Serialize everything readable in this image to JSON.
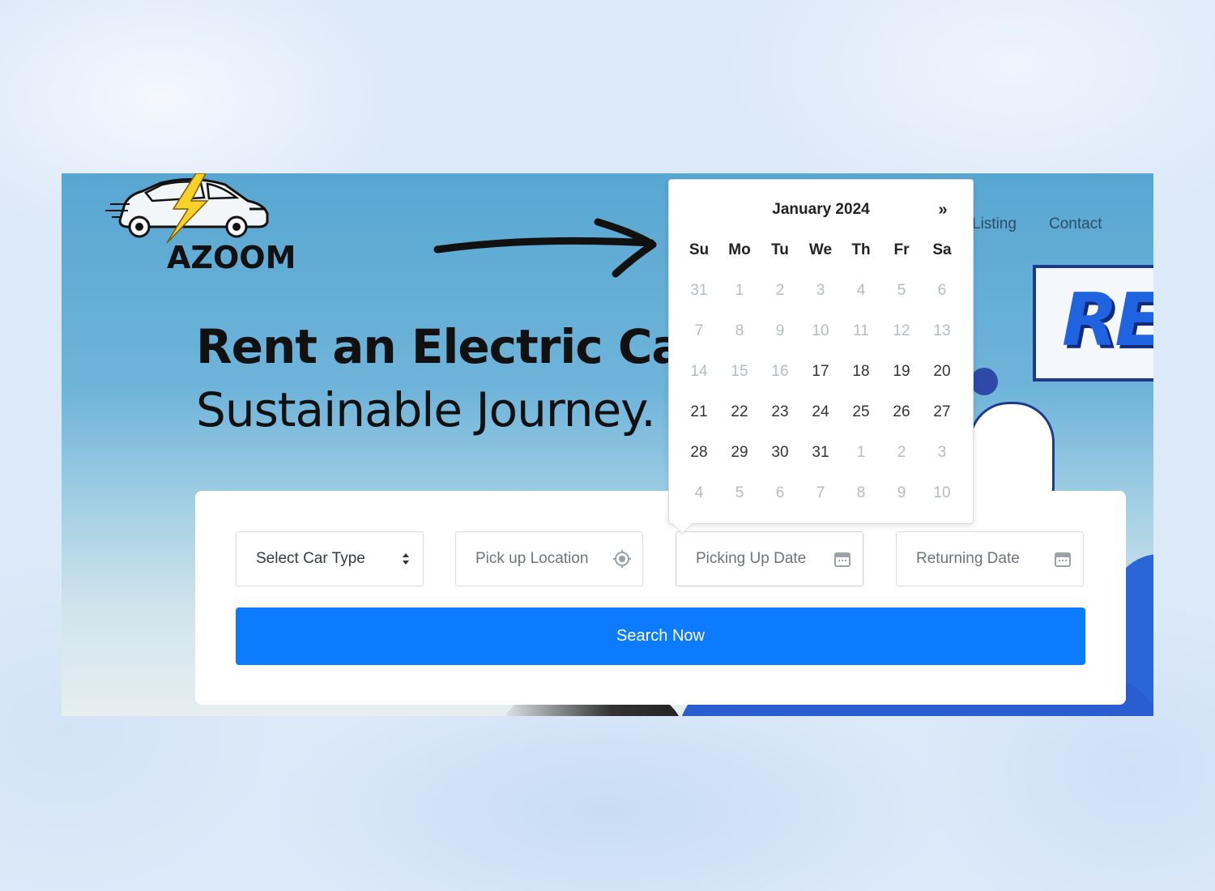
{
  "brand": {
    "name": "AZOOM"
  },
  "nav": {
    "items": [
      "Listing",
      "Contact"
    ]
  },
  "hero": {
    "title": "Rent an Electric Car",
    "subtitle": "Sustainable Journey."
  },
  "illustration": {
    "sign_text": "RE"
  },
  "search": {
    "car_type": "Select Car Type",
    "pickup_location": "Pick up Location",
    "pickup_date": "Picking Up Date",
    "return_date": "Returning Date",
    "submit": "Search Now"
  },
  "datepicker": {
    "month_label": "January 2024",
    "next_label": "»",
    "weekdays": [
      "Su",
      "Mo",
      "Tu",
      "We",
      "Th",
      "Fr",
      "Sa"
    ],
    "weeks": [
      [
        {
          "d": "31",
          "m": true
        },
        {
          "d": "1",
          "m": true
        },
        {
          "d": "2",
          "m": true
        },
        {
          "d": "3",
          "m": true
        },
        {
          "d": "4",
          "m": true
        },
        {
          "d": "5",
          "m": true
        },
        {
          "d": "6",
          "m": true
        }
      ],
      [
        {
          "d": "7",
          "m": true
        },
        {
          "d": "8",
          "m": true
        },
        {
          "d": "9",
          "m": true
        },
        {
          "d": "10",
          "m": true
        },
        {
          "d": "11",
          "m": true
        },
        {
          "d": "12",
          "m": true
        },
        {
          "d": "13",
          "m": true
        }
      ],
      [
        {
          "d": "14",
          "m": true
        },
        {
          "d": "15",
          "m": true
        },
        {
          "d": "16",
          "m": true
        },
        {
          "d": "17",
          "m": false
        },
        {
          "d": "18",
          "m": false
        },
        {
          "d": "19",
          "m": false
        },
        {
          "d": "20",
          "m": false
        }
      ],
      [
        {
          "d": "21",
          "m": false
        },
        {
          "d": "22",
          "m": false
        },
        {
          "d": "23",
          "m": false
        },
        {
          "d": "24",
          "m": false
        },
        {
          "d": "25",
          "m": false
        },
        {
          "d": "26",
          "m": false
        },
        {
          "d": "27",
          "m": false
        }
      ],
      [
        {
          "d": "28",
          "m": false
        },
        {
          "d": "29",
          "m": false
        },
        {
          "d": "30",
          "m": false
        },
        {
          "d": "31",
          "m": false
        },
        {
          "d": "1",
          "m": true
        },
        {
          "d": "2",
          "m": true
        },
        {
          "d": "3",
          "m": true
        }
      ],
      [
        {
          "d": "4",
          "m": true
        },
        {
          "d": "5",
          "m": true
        },
        {
          "d": "6",
          "m": true
        },
        {
          "d": "7",
          "m": true
        },
        {
          "d": "8",
          "m": true
        },
        {
          "d": "9",
          "m": true
        },
        {
          "d": "10",
          "m": true
        }
      ]
    ]
  },
  "colors": {
    "primary": "#0d7bff",
    "header_bg": "#58a7d2",
    "muted_day": "#b7bcc1"
  }
}
